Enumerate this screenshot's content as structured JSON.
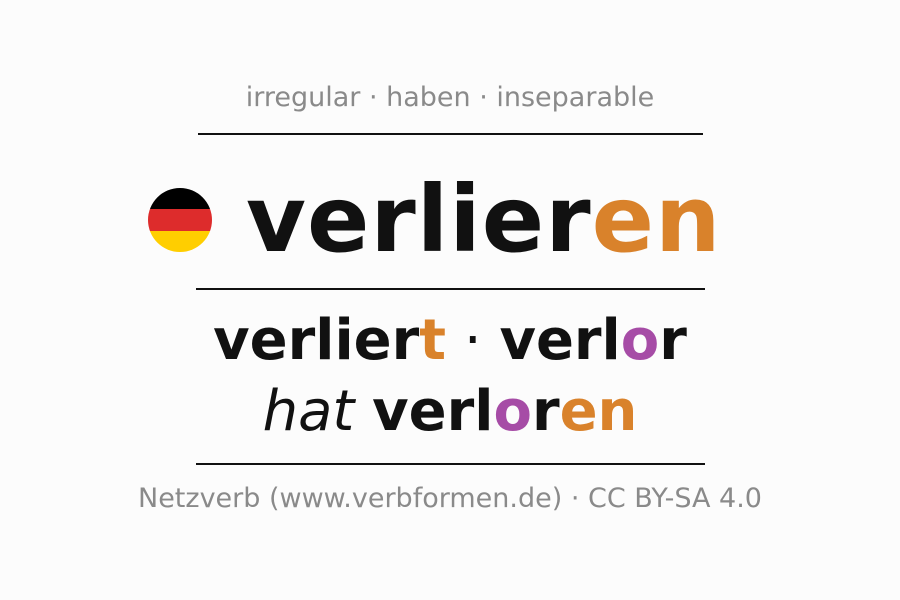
{
  "tags": "irregular · haben · inseparable",
  "flag": {
    "icon": "germany-flag-icon",
    "colors": [
      "#000000",
      "#dd2c2c",
      "#ffce00"
    ]
  },
  "headword": {
    "stem": "verlier",
    "ending": "en"
  },
  "forms": {
    "present": {
      "stem": "verlier",
      "ending": "t"
    },
    "separator": " · ",
    "past": {
      "stem": "verl",
      "vowel": "o",
      "rest": "r"
    },
    "perfect": {
      "auxiliary": "hat",
      "stem": "verl",
      "vowel": "o",
      "rest": "r",
      "ending": "en"
    }
  },
  "colors": {
    "ending": "#d9822b",
    "vowel_change": "#a64ca6",
    "text": "#111111",
    "muted": "#8a8a8a"
  },
  "footer": "Netzverb (www.verbformen.de) · CC BY-SA 4.0"
}
